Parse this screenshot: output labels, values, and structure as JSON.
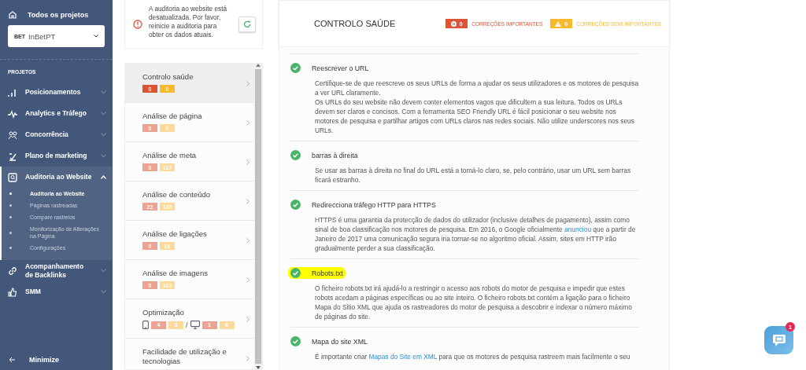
{
  "sidebar": {
    "top_link": "Todos os projetos",
    "project": {
      "logo": "BET",
      "name": "InBetPT"
    },
    "section_label": "PROJETOS",
    "items": [
      {
        "label": "Posicionamentos",
        "expanded": false
      },
      {
        "label": "Analytics e Tráfego",
        "expanded": false
      },
      {
        "label": "Concorrência",
        "expanded": false
      },
      {
        "label": "Plano de marketing",
        "expanded": false
      },
      {
        "label": "Auditoria ao Website",
        "expanded": true,
        "children": [
          {
            "label": "Auditoria ao Website",
            "selected": true
          },
          {
            "label": "Páginas rastreadas",
            "selected": false
          },
          {
            "label": "Compare rastreios",
            "selected": false
          },
          {
            "label": "Monitorização de Alterações na Página",
            "selected": false
          },
          {
            "label": "Configurações",
            "selected": false
          }
        ]
      },
      {
        "label": "Acompanhamento de Backlinks",
        "expanded": false
      },
      {
        "label": "SMM",
        "expanded": false
      }
    ],
    "footer": "Minimize"
  },
  "alert": {
    "message": "A auditoria ao website está desatualizada. Por favor, reinicie a auditoria para obter os dados atuais."
  },
  "sections": [
    {
      "label": "Controlo saúde",
      "selected": true,
      "kind": "counts",
      "counts": [
        "0",
        "0"
      ]
    },
    {
      "label": "Análise de página",
      "selected": false,
      "kind": "counts",
      "counts": [
        "0",
        "0"
      ]
    },
    {
      "label": "Análise de meta",
      "selected": false,
      "kind": "counts",
      "counts": [
        "0",
        "117"
      ]
    },
    {
      "label": "Análise de conteúdo",
      "selected": false,
      "kind": "counts",
      "counts": [
        "22",
        "135"
      ]
    },
    {
      "label": "Análise de ligações",
      "selected": false,
      "kind": "counts",
      "counts": [
        "0",
        "16"
      ]
    },
    {
      "label": "Análise de imagens",
      "selected": false,
      "kind": "counts",
      "counts": [
        "0",
        "102"
      ]
    },
    {
      "label": "Optimização",
      "selected": false,
      "kind": "devices",
      "mobile": [
        "4",
        "3"
      ],
      "separator": "/",
      "desktop": [
        "1",
        "6"
      ]
    },
    {
      "label": "Facilidade de utilização e tecnologias",
      "selected": false,
      "kind": "counts"
    }
  ],
  "header": {
    "title": "CONTROLO SAÚDE",
    "important": {
      "count": "0",
      "label": "CORREÇÕES IMPORTANTES"
    },
    "semi": {
      "count": "0",
      "label": "CORREÇÕES SEMI IMPORTANTES"
    }
  },
  "checks": [
    {
      "title": "Reescrever o URL",
      "passed": true,
      "highlighted": false,
      "paragraphs": [
        [
          {
            "text": "Certifique-se de que reescreve os seus URLs de forma a ajudar os seus utilizadores e os motores de pesquisa a ver URL claramente."
          }
        ],
        [
          {
            "text": "Os URLs do seu website não devem conter elementos vagos que dificultem a sua leitura. Todos os URLs devem ser claros e concisos. Com a ferramenta SEO Friendly URL é fácil posicionar o seu website nos motores de pesquisa e partilhar artigos com URLs claros nas redes sociais. Não utilize underscores nos seus URLs."
          }
        ]
      ]
    },
    {
      "title": "barras à direita",
      "passed": true,
      "highlighted": false,
      "paragraphs": [
        [
          {
            "text": "Se usar as barras à direita no final do URL está a torná-lo claro, se, pelo contrário, usar um URL sem barras ficará estranho."
          }
        ]
      ]
    },
    {
      "title": "Redirecciona tráfego HTTP para HTTPS",
      "passed": true,
      "highlighted": false,
      "paragraphs": [
        [
          {
            "text": "HTTPS é uma garantia da protecção de dados do utilizador (inclusive detalhes de pagamento), assim como sinal de boa classificação nos motores de pesquisa. Em 2016, o Google oficialmente "
          },
          {
            "link": "anunciou"
          },
          {
            "text": " que a partir de Janeiro de 2017 uma comunicação segura iria tornar-se no algoritmo oficial. Assim, sites em HTTP irão gradualmente perder a sua classificação."
          }
        ]
      ]
    },
    {
      "title": "Robots.txt",
      "passed": true,
      "highlighted": true,
      "paragraphs": [
        [
          {
            "text": "O ficheiro robots.txt irá ajudá-lo a restringir o acesso aos robots do motor de pesquisa e impedir que estes robots acedam a páginas específicas ou ao site inteiro. O ficheiro robots.txt contém a ligação para o ficheiro Mapa do Sitio XML que ajuda os rastreadores do motor de pesquisa a descobrir e indexar o número máximo de páginas do site."
          }
        ]
      ]
    },
    {
      "title": "Mapa do site XML",
      "passed": true,
      "highlighted": false,
      "paragraphs": [
        [
          {
            "text": "É importante criar "
          },
          {
            "link": "Mapas do Site em XML"
          },
          {
            "text": " para que os motores de pesquisa rastreem mais facilmente o seu"
          }
        ]
      ]
    }
  ],
  "chat": {
    "badge": "1"
  }
}
